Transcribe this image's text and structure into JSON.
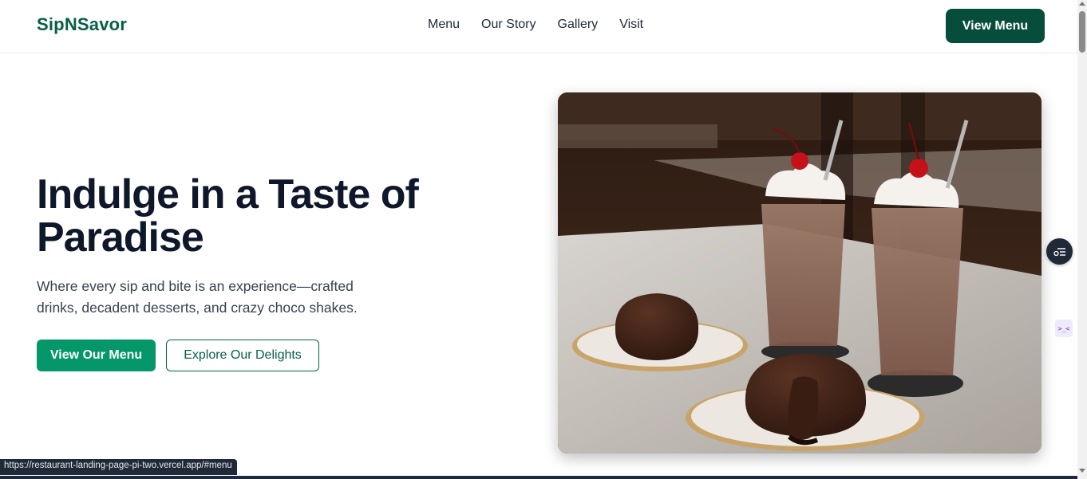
{
  "header": {
    "brand": "SipNSavor",
    "nav": [
      "Menu",
      "Our Story",
      "Gallery",
      "Visit"
    ],
    "cta_label": "View Menu"
  },
  "hero": {
    "title_line1": "Indulge in a Taste of",
    "title_line2": "Paradise",
    "subtitle": "Where every sip and bite is an experience—crafted drinks, decadent desserts, and crazy choco shakes.",
    "primary_button": "View Our Menu",
    "secondary_button": "Explore Our Delights"
  },
  "widgets": {
    "side_widget_b_text": ">_<"
  },
  "status": {
    "url": "https://restaurant-landing-page-pi-two.vercel.app/#menu"
  },
  "colors": {
    "brand": "#065f46",
    "primary": "#059669",
    "dark_button": "#064e3b"
  }
}
